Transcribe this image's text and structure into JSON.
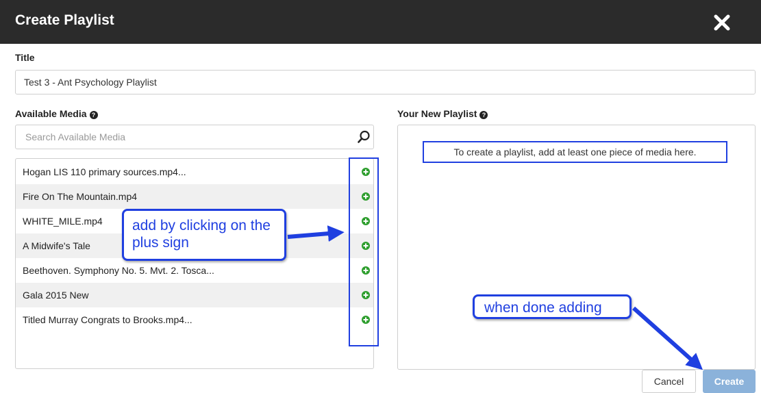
{
  "dialog": {
    "title": "Create Playlist",
    "close_icon": "close-x-icon"
  },
  "title_field": {
    "label": "Title",
    "value": "Test 3 - Ant Psychology Playlist"
  },
  "available_media": {
    "label": "Available Media",
    "help_icon": "question-circle-icon",
    "search_placeholder": "Search Available Media",
    "search_icon": "magnifier-icon",
    "items": [
      {
        "name": "Hogan LIS 110 primary sources.mp4..."
      },
      {
        "name": "Fire On The Mountain.mp4"
      },
      {
        "name": "WHITE_MILE.mp4"
      },
      {
        "name": "A Midwife's Tale"
      },
      {
        "name": "Beethoven. Symphony No. 5. Mvt. 2. Tosca..."
      },
      {
        "name": "Gala 2015 New"
      },
      {
        "name": "Titled Murray Congrats to Brooks.mp4..."
      }
    ],
    "add_icon": "plus-circle-icon"
  },
  "playlist": {
    "label": "Your New Playlist",
    "help_icon": "question-circle-icon",
    "empty_hint": "To create a playlist, add at least one piece of media here."
  },
  "buttons": {
    "cancel": "Cancel",
    "create": "Create"
  },
  "annotations": {
    "plus_sign": "add by clicking on the plus sign",
    "done": "when done adding"
  },
  "colors": {
    "titlebar": "#2b2b2b",
    "annotation": "#1f3fe0",
    "add_green": "#2e9e2e",
    "create_button": "#8bb2da"
  }
}
